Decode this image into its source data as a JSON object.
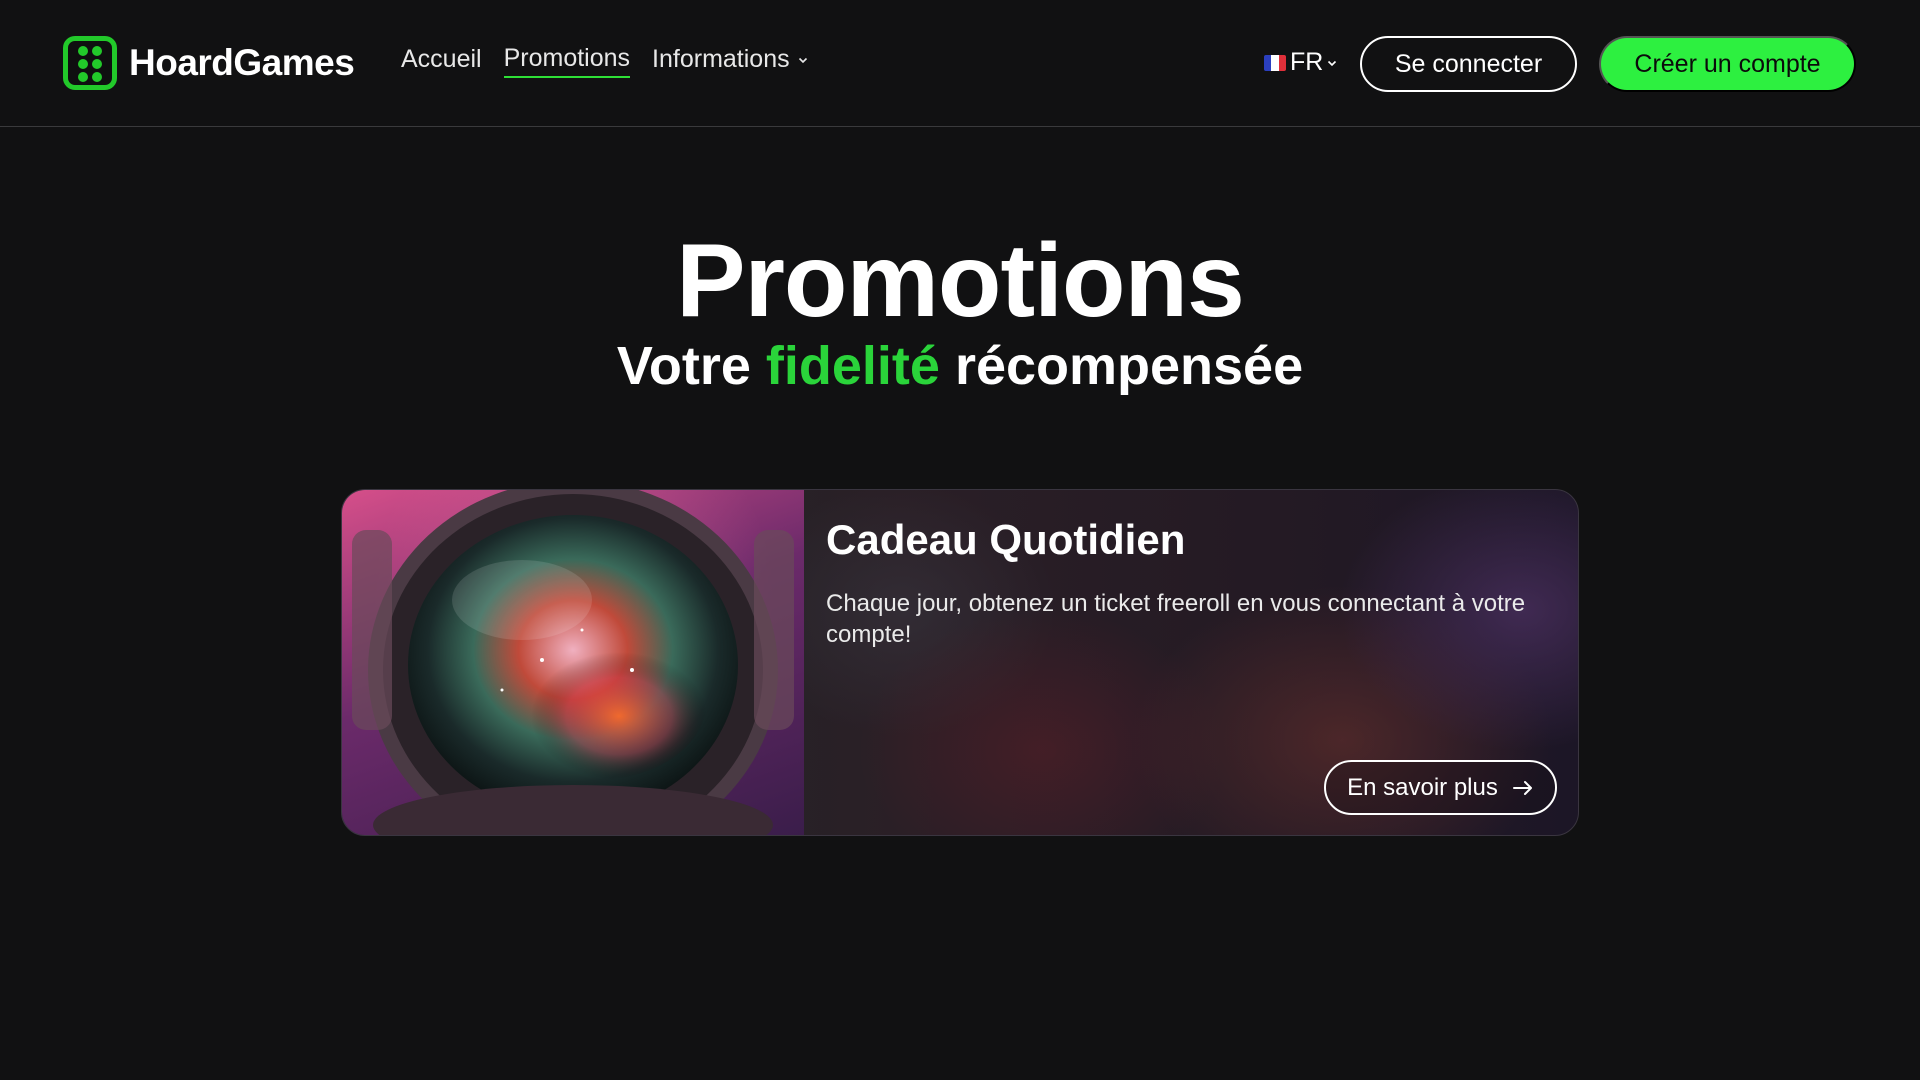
{
  "brand": {
    "name": "HoardGames",
    "accent": "#2df040"
  },
  "nav": {
    "items": [
      {
        "label": "Accueil",
        "active": false
      },
      {
        "label": "Promotions",
        "active": true
      },
      {
        "label": "Informations",
        "active": false,
        "dropdown": true
      }
    ]
  },
  "language": {
    "code": "FR",
    "flag_icon": "france-flag-icon"
  },
  "auth": {
    "login_label": "Se connecter",
    "signup_label": "Créer un compte"
  },
  "hero": {
    "title": "Promotions",
    "subtitle_before": "Votre ",
    "subtitle_accent": "fidelité",
    "subtitle_after": " récompensée"
  },
  "promo": {
    "title": "Cadeau Quotidien",
    "description": "Chaque jour, obtenez un ticket freeroll en vous connectant à votre compte!",
    "button_label": "En savoir plus",
    "image_icon": "astronaut-helmet-image"
  }
}
